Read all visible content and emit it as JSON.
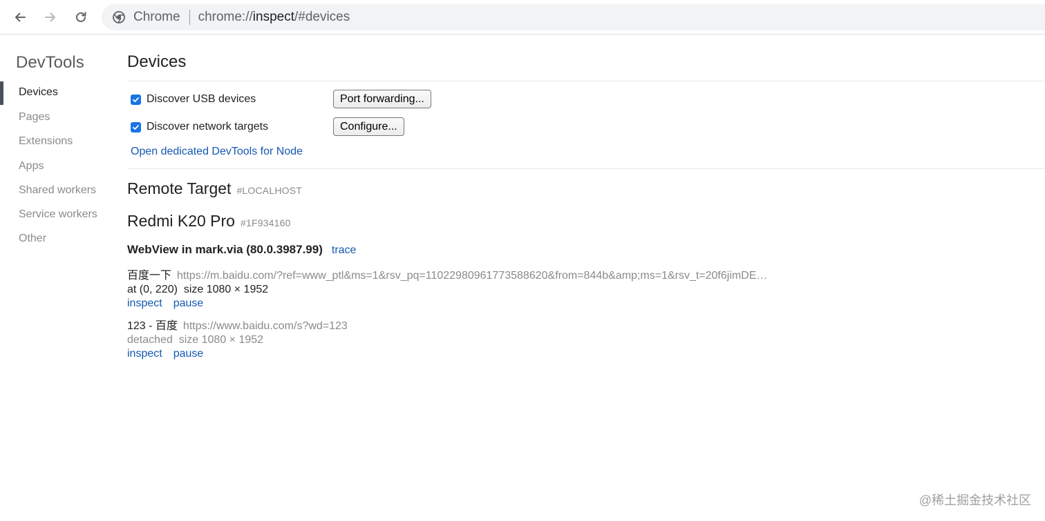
{
  "browser": {
    "omnibox_label": "Chrome",
    "url_prefix": "chrome://",
    "url_host": "inspect",
    "url_suffix": "/#devices"
  },
  "sidebar": {
    "title": "DevTools",
    "items": [
      {
        "label": "Devices",
        "selected": true
      },
      {
        "label": "Pages"
      },
      {
        "label": "Extensions"
      },
      {
        "label": "Apps"
      },
      {
        "label": "Shared workers"
      },
      {
        "label": "Service workers"
      },
      {
        "label": "Other"
      }
    ]
  },
  "main": {
    "title": "Devices",
    "discover_usb": {
      "label": "Discover USB devices",
      "checked": true
    },
    "discover_network": {
      "label": "Discover network targets",
      "checked": true
    },
    "port_forwarding_label": "Port forwarding...",
    "configure_label": "Configure...",
    "node_link": "Open dedicated DevTools for Node",
    "remote_target": {
      "title": "Remote Target",
      "tag": "#LOCALHOST"
    },
    "device": {
      "name": "Redmi K20 Pro",
      "serial": "#1F934160"
    },
    "browser": {
      "name": "WebView in mark.via (80.0.3987.99)",
      "trace_label": "trace"
    },
    "targets": [
      {
        "name": "百度一下",
        "url": "https://m.baidu.com/?ref=www_ptl&ms=1&rsv_pq=11022980961773588620&from=844b&amp;ms=1&rsv_t=20f6jimDE…",
        "position": "at (0, 220)",
        "size": "size 1080 × 1952",
        "inspect_label": "inspect",
        "pause_label": "pause"
      },
      {
        "name": "123 - 百度",
        "url": "https://www.baidu.com/s?wd=123",
        "position": "detached",
        "size": "size 1080 × 1952",
        "inspect_label": "inspect",
        "pause_label": "pause"
      }
    ]
  },
  "watermark": "@稀土掘金技术社区",
  "colors": {
    "accent": "#1a73e8",
    "link": "#1558b0",
    "muted": "#8a8a8a"
  }
}
